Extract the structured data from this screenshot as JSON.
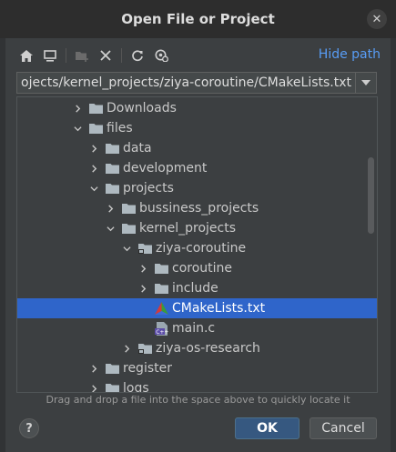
{
  "dialog": {
    "title": "Open File or Project",
    "close_icon": "close-icon"
  },
  "toolbar": {
    "buttons": [
      {
        "name": "home-icon",
        "enabled": true
      },
      {
        "name": "desktop-icon",
        "enabled": true
      },
      {
        "name": "new-folder-icon",
        "enabled": false
      },
      {
        "name": "delete-icon",
        "enabled": true
      },
      {
        "name": "refresh-icon",
        "enabled": true
      },
      {
        "name": "show-hidden-icon",
        "enabled": true
      }
    ],
    "hide_path_label": "Hide path"
  },
  "path": {
    "value": "/home/user/files/projects/kernel_projects/ziya-coroutine/CMakeLists.txt",
    "visible_value": "ojects/kernel_projects/ziya-coroutine/CMakeLists.txt"
  },
  "tree": {
    "rows": [
      {
        "label": "Downloads",
        "depth": 3,
        "expanded": false,
        "icon": "folder-icon"
      },
      {
        "label": "files",
        "depth": 3,
        "expanded": true,
        "icon": "folder-icon"
      },
      {
        "label": "data",
        "depth": 4,
        "expanded": false,
        "icon": "folder-icon"
      },
      {
        "label": "development",
        "depth": 4,
        "expanded": false,
        "icon": "folder-icon"
      },
      {
        "label": "projects",
        "depth": 4,
        "expanded": true,
        "icon": "folder-icon"
      },
      {
        "label": "bussiness_projects",
        "depth": 5,
        "expanded": false,
        "icon": "folder-icon"
      },
      {
        "label": "kernel_projects",
        "depth": 5,
        "expanded": true,
        "icon": "folder-icon"
      },
      {
        "label": "ziya-coroutine",
        "depth": 6,
        "expanded": true,
        "icon": "project-folder-icon"
      },
      {
        "label": "coroutine",
        "depth": 7,
        "expanded": false,
        "icon": "folder-icon"
      },
      {
        "label": "include",
        "depth": 7,
        "expanded": false,
        "icon": "folder-icon"
      },
      {
        "label": "CMakeLists.txt",
        "depth": 7,
        "leaf": true,
        "selected": true,
        "icon": "cmake-file-icon"
      },
      {
        "label": "main.c",
        "depth": 7,
        "leaf": true,
        "icon": "c-file-icon"
      },
      {
        "label": "ziya-os-research",
        "depth": 6,
        "expanded": false,
        "icon": "project-folder-icon"
      },
      {
        "label": "register",
        "depth": 4,
        "expanded": false,
        "icon": "folder-icon"
      },
      {
        "label": "logs",
        "depth": 4,
        "expanded": false,
        "icon": "folder-icon"
      }
    ]
  },
  "hint": "Drag and drop a file into the space above to quickly locate it",
  "buttons": {
    "help_label": "?",
    "ok_label": "OK",
    "cancel_label": "Cancel"
  },
  "colors": {
    "background": "#3c3f41",
    "selection": "#2f65ca",
    "link": "#589df6",
    "folder": "#aeb9c0",
    "ok_button": "#365880"
  }
}
